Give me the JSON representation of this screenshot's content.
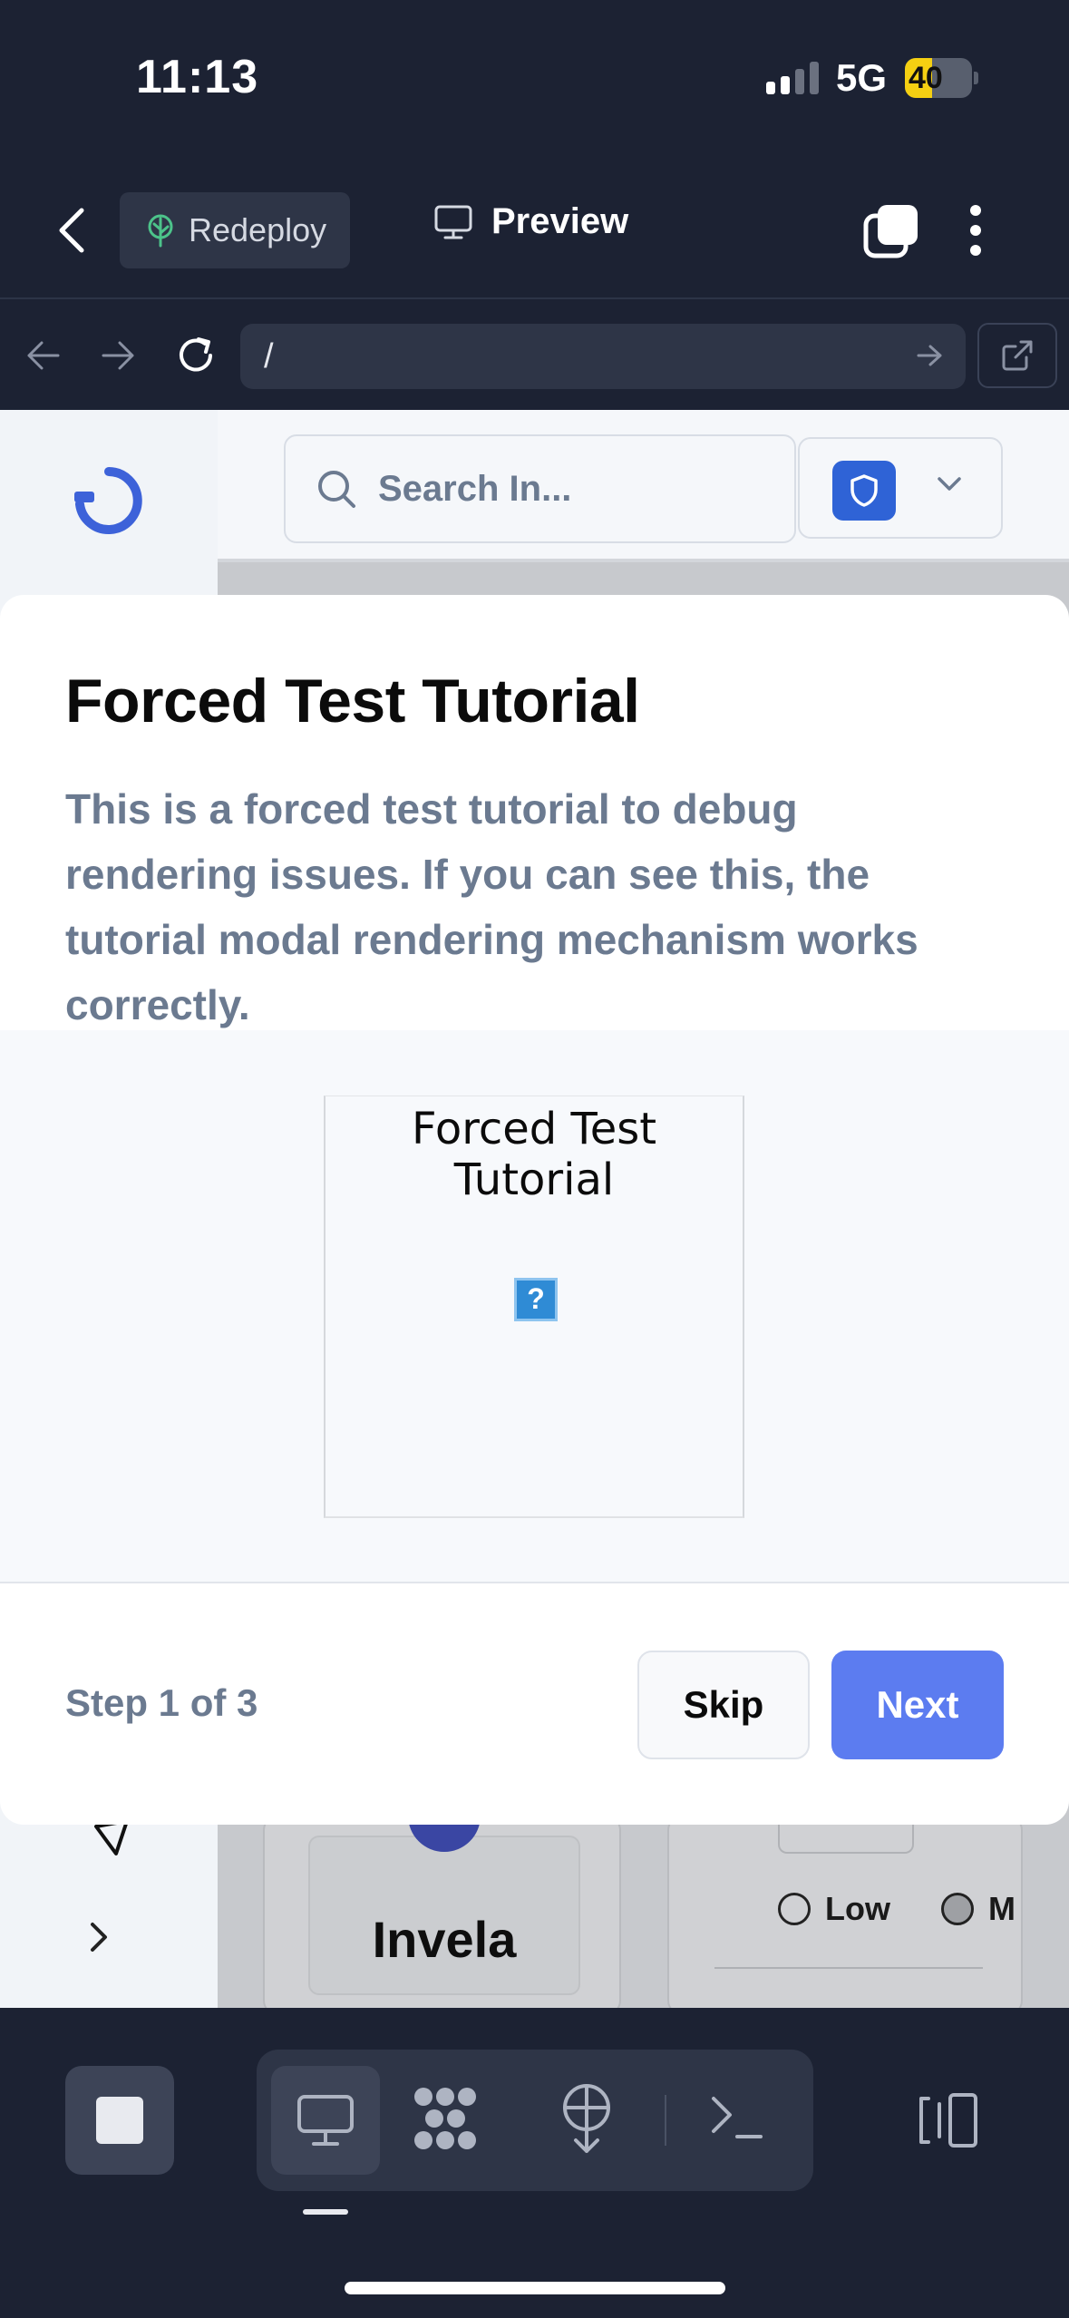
{
  "status_bar": {
    "time": "11:13",
    "network": "5G",
    "battery_level": "40",
    "battery_fraction": 0.4,
    "battery_color": "#f5d012"
  },
  "app_header": {
    "back_icon": "chevron-left-icon",
    "redeploy_label": "Redeploy",
    "redeploy_icon": "deploy-tree-icon",
    "preview_label": "Preview",
    "preview_icon": "monitor-icon",
    "tabs_icon": "tabs-icon",
    "menu_icon": "kebab-menu-icon"
  },
  "browser_bar": {
    "url": "/",
    "icons": [
      "arrow-left-icon",
      "arrow-right-icon",
      "reload-icon",
      "go-arrow-icon",
      "open-external-icon"
    ]
  },
  "page": {
    "search_placeholder": "Search In...",
    "card_title": "Invela",
    "radio_low": "Low",
    "radio_medium": "M",
    "accent_color": "#2f63d6"
  },
  "modal": {
    "title": "Forced Test Tutorial",
    "description": "This is a forced test tutorial to debug rendering issues. If you can see this, the tutorial modal rendering mechanism works correctly.",
    "media_alt": "Forced Test Tutorial",
    "broken_image_glyph": "?",
    "step": "Step 1 of 3",
    "skip_label": "Skip",
    "next_label": "Next",
    "next_color": "#5c7cf0"
  },
  "bottom_toolbar": {
    "icons": [
      "stop-icon",
      "desktop-icon",
      "dots-grid-icon",
      "deploy-icon",
      "terminal-icon",
      "panel-toggle-icon"
    ]
  }
}
